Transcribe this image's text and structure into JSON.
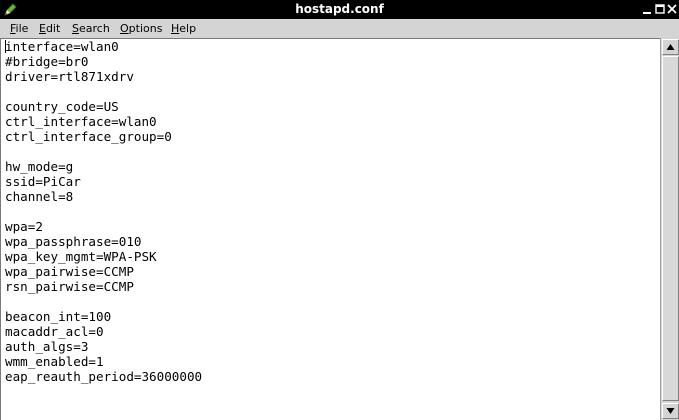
{
  "window": {
    "title": "hostapd.conf",
    "app_icon": "leafpad-pencil-icon",
    "controls": [
      "minimize-icon",
      "maximize-icon",
      "close-icon"
    ]
  },
  "menubar": {
    "items": [
      {
        "mnemonic": "F",
        "rest": "ile"
      },
      {
        "mnemonic": "E",
        "rest": "dit"
      },
      {
        "mnemonic": "S",
        "rest": "earch"
      },
      {
        "mnemonic": "O",
        "rest": "ptions"
      },
      {
        "mnemonic": "H",
        "rest": "elp"
      }
    ]
  },
  "editor": {
    "lines": [
      "interface=wlan0",
      "#bridge=br0",
      "driver=rtl871xdrv",
      "",
      "country_code=US",
      "ctrl_interface=wlan0",
      "ctrl_interface_group=0",
      "",
      "hw_mode=g",
      "ssid=PiCar",
      "channel=8",
      "",
      "wpa=2",
      "wpa_passphrase=010",
      "wpa_key_mgmt=WPA-PSK",
      "wpa_pairwise=CCMP",
      "rsn_pairwise=CCMP",
      "",
      "beacon_int=100",
      "macaddr_acl=0",
      "auth_algs=3",
      "wmm_enabled=1",
      "eap_reauth_period=36000000"
    ]
  },
  "scrollbar": {
    "up_icon": "arrow-up-icon",
    "down_icon": "arrow-down-icon"
  }
}
